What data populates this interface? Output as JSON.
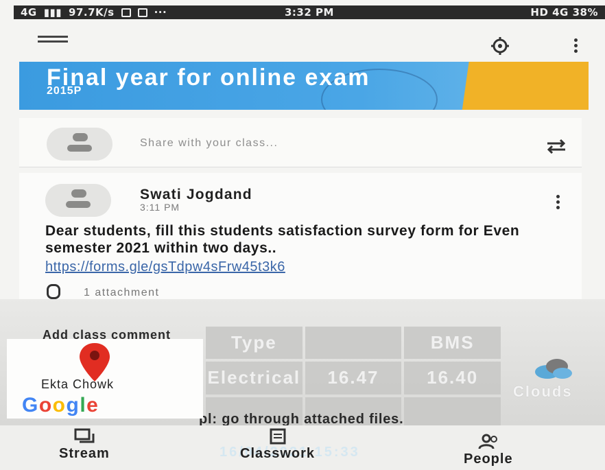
{
  "status_bar": {
    "network": "4G",
    "speed": "97.7K/s",
    "time": "3:32 PM",
    "right": "HD 4G 38%"
  },
  "banner": {
    "title": "Final year for online exam",
    "subtitle": "2015P"
  },
  "share": {
    "placeholder": "Share with your class..."
  },
  "post": {
    "author": "Swati Jogdand",
    "time": "3:11 PM",
    "body": "Dear students, fill this students satisfaction survey form for Even semester 2021 within two days..",
    "link": "https://forms.gle/gsTdpw4sFrw45t3k6",
    "attachments": "1 attachment"
  },
  "comment": {
    "placeholder": "Add class comment",
    "partial_text": "pl: go through attached files."
  },
  "overlay_map": {
    "place": "Ekta Chowk",
    "logo_letters": [
      "G",
      "o",
      "o",
      "g",
      "l",
      "e"
    ]
  },
  "ghost_table": {
    "cells": [
      "Type",
      "",
      "BMS",
      "Electrical",
      "16.47",
      "16.40",
      "",
      "",
      ""
    ]
  },
  "ghost_side": {
    "line1": "Clouds",
    "line2": "",
    "line3": ""
  },
  "ghost_footer": "16/04/2021 15:33",
  "bottom_nav": {
    "stream": "Stream",
    "classwork": "Classwork",
    "people": "People"
  }
}
